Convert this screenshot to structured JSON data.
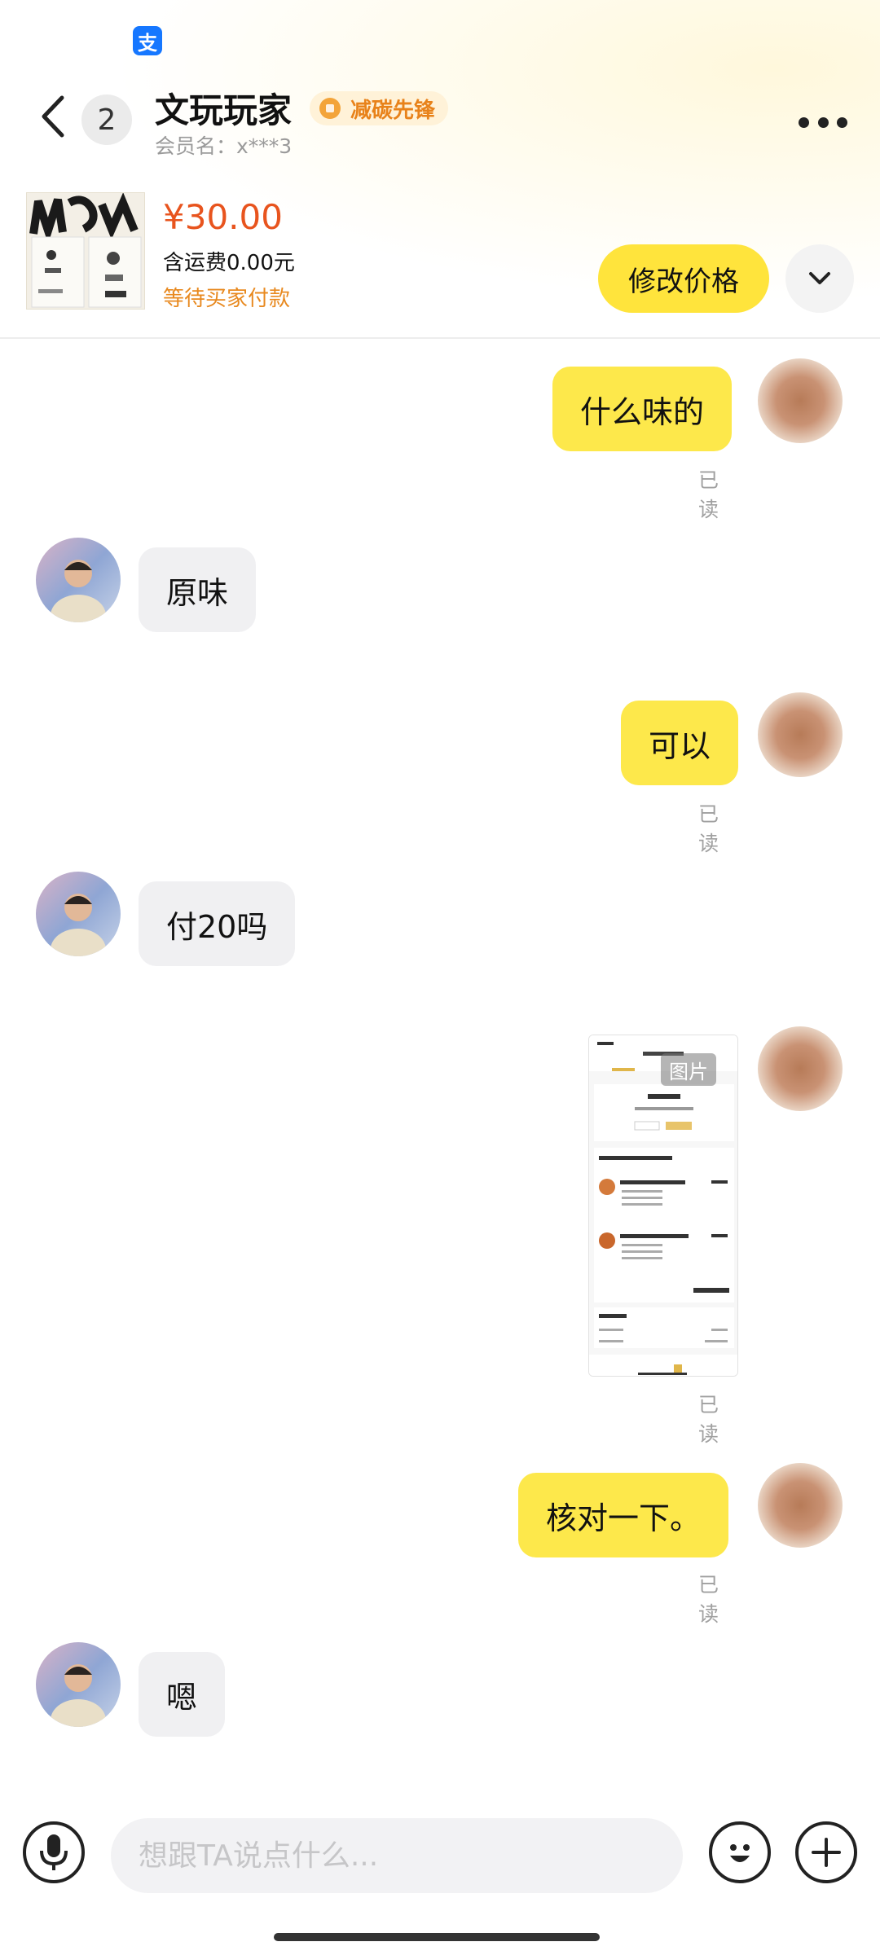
{
  "status_bar": {
    "app_badge": "支"
  },
  "header": {
    "unread_count": "2",
    "contact_name": "文玩玩家",
    "badge_label": "减碳先锋",
    "member_label": "会员名：x***3"
  },
  "product": {
    "price": "¥30.00",
    "shipping": "含运费0.00元",
    "status": "等待买家付款",
    "edit_price_label": "修改价格"
  },
  "messages": [
    {
      "side": "out",
      "text": "什么味的",
      "read": "已读"
    },
    {
      "side": "in",
      "text": "原味"
    },
    {
      "side": "out",
      "text": "可以",
      "read": "已读"
    },
    {
      "side": "in",
      "text": "付20吗"
    },
    {
      "side": "out",
      "type": "image",
      "tag": "图片",
      "read": "已读"
    },
    {
      "side": "out",
      "text": "核对一下。",
      "read": "已读"
    },
    {
      "side": "in",
      "text": "嗯"
    }
  ],
  "input": {
    "placeholder": "想跟TA说点什么..."
  },
  "colors": {
    "accent_yellow": "#fde84b",
    "button_yellow": "#ffe43c",
    "price_red": "#e8541e",
    "status_orange": "#e8891f",
    "alipay_blue": "#1677ff"
  }
}
